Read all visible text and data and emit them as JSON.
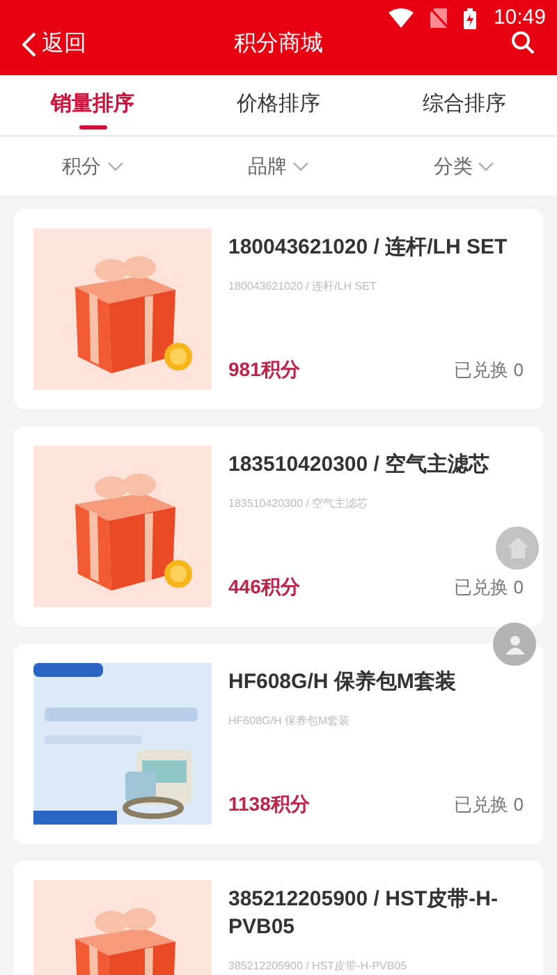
{
  "status_bar": {
    "time": "10:49"
  },
  "header": {
    "back_label": "返回",
    "title": "积分商城"
  },
  "tabs": [
    {
      "label": "销量排序",
      "selected": true
    },
    {
      "label": "价格排序",
      "selected": false
    },
    {
      "label": "综合排序",
      "selected": false
    }
  ],
  "filters": [
    {
      "label": "积分"
    },
    {
      "label": "品牌"
    },
    {
      "label": "分类"
    }
  ],
  "products": [
    {
      "kind": "gift",
      "title": "180043621020 / 连杆/LH SET",
      "subtitle": "180043621020 / 连杆/LH SET",
      "points": "981积分",
      "exchanged": "已兑换 0"
    },
    {
      "kind": "gift",
      "title": "183510420300 / 空气主滤芯",
      "subtitle": "183510420300 / 空气主滤芯",
      "points": "446积分",
      "exchanged": "已兑换 0"
    },
    {
      "kind": "kit",
      "title": "HF608G/H 保养包M套装",
      "subtitle": "HF608G/H 保养包M套装",
      "points": "1138积分",
      "exchanged": "已兑换 0"
    },
    {
      "kind": "gift",
      "title": "385212205900 / HST皮带-H-PVB05",
      "subtitle": "385212205900 / HST皮带-H-PVB05"
    }
  ]
}
